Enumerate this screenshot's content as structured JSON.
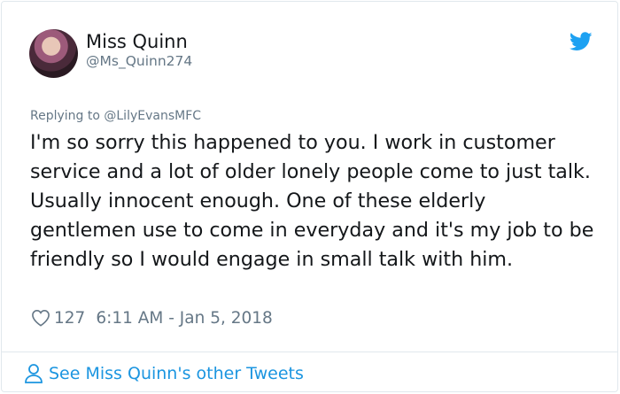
{
  "tweet": {
    "author_name": "Miss Quinn",
    "author_handle": "@Ms_Quinn274",
    "replying_to": "Replying to @LilyEvansMFC",
    "text": "I'm so sorry this happened to you. I work in customer service and a lot of older lonely people come to just talk. Usually innocent enough. One of these elderly gentlemen use to come in everyday and it's my job to be friendly so I would engage in small talk with him.",
    "like_count": "127",
    "timestamp": "6:11 AM - Jan 5, 2018"
  },
  "footer": {
    "link_label": "See Miss Quinn's other Tweets"
  },
  "icons": {
    "brand": "twitter-bird-icon",
    "like": "heart-icon",
    "profile": "person-icon"
  },
  "colors": {
    "accent": "#1da1f2",
    "link": "#1b95e0",
    "muted": "#657786",
    "text": "#14171a",
    "border": "#e1e8ed"
  }
}
